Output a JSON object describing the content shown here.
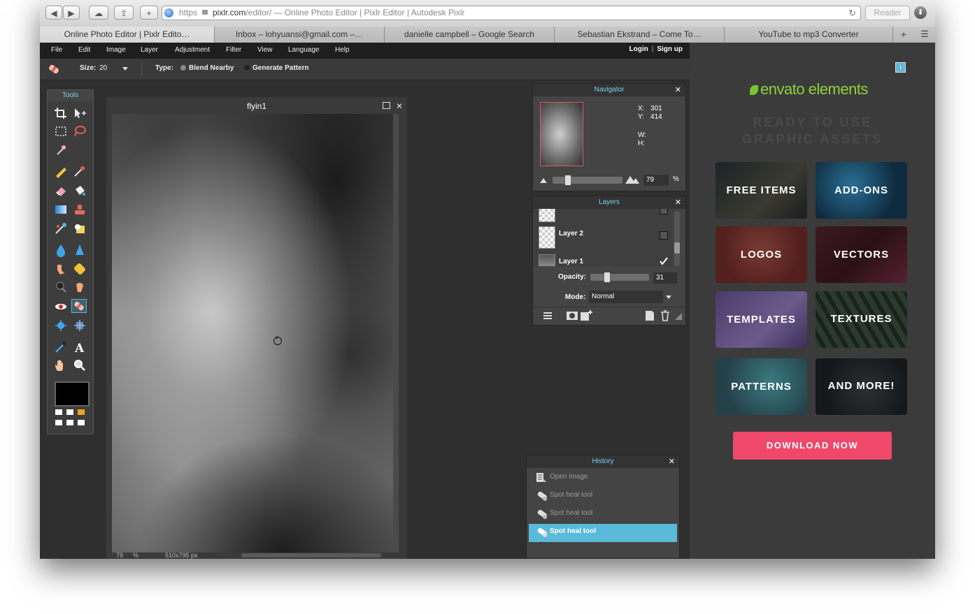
{
  "browser": {
    "back": "◀",
    "forward": "▶",
    "cloud": "☁",
    "share": "⇪",
    "newtab": "+",
    "url_scheme": "https",
    "url_host": "pixlr.com",
    "url_path": "/editor/",
    "url_title": " — Online Photo Editor | Pixlr Editor | Autodesk Pixlr",
    "reader": "Reader",
    "download_icon": "⬇",
    "reload": "↻"
  },
  "tabs": [
    {
      "label": "Online Photo Editor | Pixlr Edito…"
    },
    {
      "label": "Inbox – lohyuansi@gmail.com –…"
    },
    {
      "label": "danielle campbell – Google Search"
    },
    {
      "label": "Sebastian Ekstrand – Come To…"
    },
    {
      "label": "YouTube to mp3 Converter"
    }
  ],
  "tab_plus": "+",
  "tab_menu": "☰",
  "menu": [
    "File",
    "Edit",
    "Image",
    "Layer",
    "Adjustment",
    "Filter",
    "View",
    "Language",
    "Help"
  ],
  "auth": {
    "login": "Login",
    "sep": "|",
    "signup": "Sign up"
  },
  "options": {
    "size_label": "Size:",
    "size_value": "20",
    "type_label": "Type:",
    "blend": "Blend Nearby",
    "generate": "Generate Pattern"
  },
  "tools": {
    "title": "Tools"
  },
  "image_window": {
    "title": "flyin1",
    "zoom": "79",
    "zoom_unit": "%",
    "dims": "510x795 px"
  },
  "navigator": {
    "title": "Navigator",
    "x_label": "X:",
    "x_value": "301",
    "y_label": "Y:",
    "y_value": "414",
    "w_label": "W:",
    "h_label": "H:",
    "zoom": "79",
    "zoom_unit": "%"
  },
  "layers": {
    "title": "Layers",
    "items": [
      {
        "name": ""
      },
      {
        "name": "Layer 2"
      },
      {
        "name": "Layer 1"
      }
    ],
    "opacity_label": "Opacity:",
    "opacity_value": "31",
    "mode_label": "Mode:",
    "mode_value": "Normal"
  },
  "history": {
    "title": "History",
    "items": [
      {
        "label": "Open image"
      },
      {
        "label": "Spot heal tool"
      },
      {
        "label": "Spot heal tool"
      },
      {
        "label": "Spot heal tool"
      }
    ]
  },
  "ad": {
    "brand": "envato elements",
    "tagline1": "READY TO USE",
    "tagline2": "GRAPHIC ASSETS",
    "tiles": [
      "FREE ITEMS",
      "ADD-ONS",
      "LOGOS",
      "VECTORS",
      "TEMPLATES",
      "TEXTURES",
      "PATTERNS",
      "AND MORE!"
    ],
    "cta": "DOWNLOAD NOW",
    "info": "i"
  },
  "close_glyph": "✕",
  "colors": {
    "accent": "#59bad9",
    "cta": "#f0486b",
    "envato_green": "#8bd43a"
  }
}
